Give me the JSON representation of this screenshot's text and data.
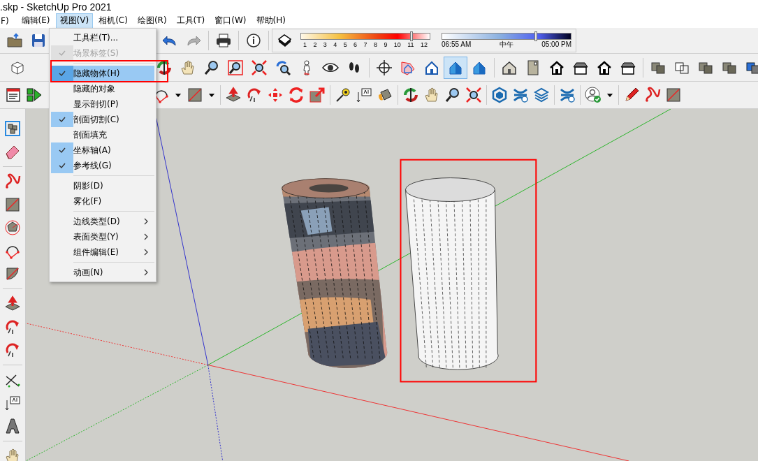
{
  "window": {
    "title": ".skp - SketchUp Pro 2021"
  },
  "menu_bar": [
    {
      "label": "F)",
      "selected": false
    },
    {
      "label": "编辑(E)",
      "selected": false
    },
    {
      "label": "视图(V)",
      "selected": true
    },
    {
      "label": "相机(C)",
      "selected": false
    },
    {
      "label": "绘图(R)",
      "selected": false
    },
    {
      "label": "工具(T)",
      "selected": false
    },
    {
      "label": "窗口(W)",
      "selected": false
    },
    {
      "label": "帮助(H)",
      "selected": false
    }
  ],
  "view_menu": {
    "items": [
      {
        "kind": "item",
        "label": "工具栏(T)...",
        "checked": false,
        "disabled": false,
        "submenu": false,
        "selected": false
      },
      {
        "kind": "item",
        "label": "场景标签(S)",
        "checked": true,
        "disabled": true,
        "submenu": false,
        "selected": false
      },
      {
        "kind": "separator"
      },
      {
        "kind": "item",
        "label": "隐藏物体(H)",
        "checked": true,
        "disabled": false,
        "submenu": false,
        "selected": true
      },
      {
        "kind": "item",
        "label": "隐藏的对象",
        "checked": false,
        "disabled": false,
        "submenu": false,
        "selected": false
      },
      {
        "kind": "item",
        "label": "显示剖切(P)",
        "checked": false,
        "disabled": false,
        "submenu": false,
        "selected": false
      },
      {
        "kind": "item",
        "label": "剖面切割(C)",
        "checked": true,
        "disabled": false,
        "submenu": false,
        "selected": false
      },
      {
        "kind": "item",
        "label": "剖面填充",
        "checked": false,
        "disabled": false,
        "submenu": false,
        "selected": false
      },
      {
        "kind": "item",
        "label": "坐标轴(A)",
        "checked": true,
        "disabled": false,
        "submenu": false,
        "selected": false
      },
      {
        "kind": "item",
        "label": "参考线(G)",
        "checked": true,
        "disabled": false,
        "submenu": false,
        "selected": false
      },
      {
        "kind": "separator"
      },
      {
        "kind": "item",
        "label": "阴影(D)",
        "checked": false,
        "disabled": false,
        "submenu": false,
        "selected": false
      },
      {
        "kind": "item",
        "label": "雾化(F)",
        "checked": false,
        "disabled": false,
        "submenu": false,
        "selected": false
      },
      {
        "kind": "separator"
      },
      {
        "kind": "item",
        "label": "边线类型(D)",
        "checked": false,
        "disabled": false,
        "submenu": true,
        "selected": false
      },
      {
        "kind": "item",
        "label": "表面类型(Y)",
        "checked": false,
        "disabled": false,
        "submenu": true,
        "selected": false
      },
      {
        "kind": "item",
        "label": "组件编辑(E)",
        "checked": false,
        "disabled": false,
        "submenu": true,
        "selected": false
      },
      {
        "kind": "separator"
      },
      {
        "kind": "item",
        "label": "动画(N)",
        "checked": false,
        "disabled": false,
        "submenu": true,
        "selected": false
      }
    ]
  },
  "shadow_panel": {
    "month_slider": {
      "level": 0.86,
      "ticks": [
        "1",
        "2",
        "3",
        "4",
        "5",
        "6",
        "7",
        "8",
        "9",
        "10",
        "11",
        "12"
      ]
    },
    "time_slider": {
      "level": 0.73,
      "labels": [
        "06:55 AM",
        "中午",
        "05:00 PM"
      ]
    }
  },
  "face_style_buttons": [
    {
      "selected": false
    },
    {
      "selected": false
    },
    {
      "selected": true
    },
    {
      "selected": false
    }
  ]
}
